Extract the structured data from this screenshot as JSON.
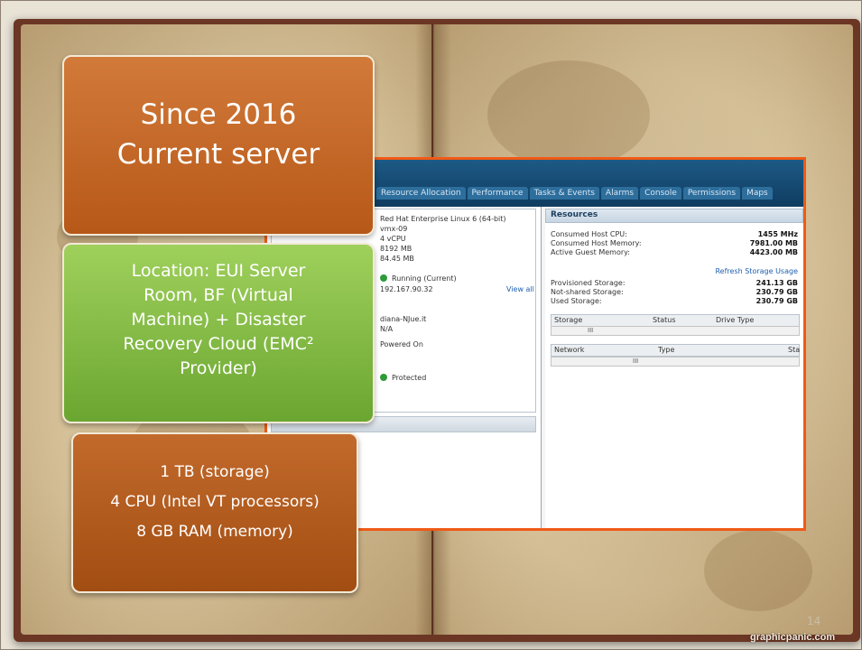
{
  "title_box": {
    "line1": "Since 2016",
    "line2": "Current server"
  },
  "location_box": {
    "text": "Location: EUI Server\nRoom, BF (Virtual\nMachine) + Disaster\nRecovery Cloud (EMC²\nProvider)"
  },
  "specs_box": {
    "items": [
      "1 TB (storage)",
      "4 CPU (Intel VT processors)",
      "8 GB RAM (memory)"
    ]
  },
  "screenshot": {
    "tabs": [
      "ry",
      "Resource Allocation",
      "Performance",
      "Tasks & Events",
      "Alarms",
      "Console",
      "Permissions",
      "Maps"
    ],
    "summary": {
      "guest_os": "Red Hat Enterprise Linux 6 (64-bit)",
      "vm_name": "vmx-09",
      "cpu": "4 vCPU",
      "memory": "8192 MB",
      "memory_overhead": "84.45 MB",
      "vmware_tools": "Running (Current)",
      "ip": "192.167.90.32",
      "view_all": "View all",
      "dns_name": "diana-NJue.it",
      "state_na": "N/A",
      "power": "Powered On",
      "protection": "Protected"
    },
    "resources": {
      "heading": "Resources",
      "rows": [
        {
          "label": "Consumed Host CPU:",
          "value": "1455 MHz"
        },
        {
          "label": "Consumed Host Memory:",
          "value": "7981.00 MB"
        },
        {
          "label": "Active Guest Memory:",
          "value": "4423.00 MB"
        }
      ],
      "refresh_link": "Refresh Storage Usage",
      "storage_rows": [
        {
          "label": "Provisioned Storage:",
          "value": "241.13 GB"
        },
        {
          "label": "Not-shared Storage:",
          "value": "230.79 GB"
        },
        {
          "label": "Used Storage:",
          "value": "230.79 GB"
        }
      ],
      "storage_headers": [
        "Storage",
        "Status",
        "Drive Type"
      ],
      "network_headers": [
        "Network",
        "Type",
        "Sta"
      ],
      "scroll_glyph": "III"
    }
  },
  "slide_number": "14",
  "watermark": "graphicpanic.com",
  "colors": {
    "title_orange": "#c0621f",
    "location_green": "#8dc04a",
    "specs_orange": "#b45a1c",
    "screenshot_border": "#f05a16"
  }
}
